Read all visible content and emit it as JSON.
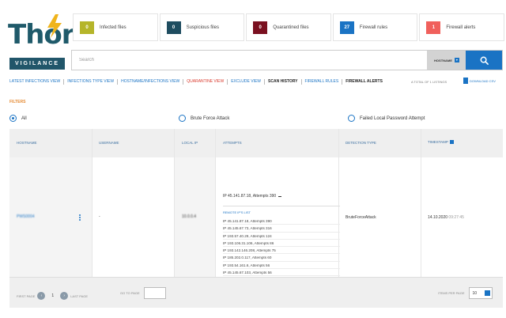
{
  "brand": {
    "logo": "Thor",
    "tagline": "VIGILANCE"
  },
  "stats": [
    {
      "count": "0",
      "label": "Infected files",
      "color": "#b5b52a"
    },
    {
      "count": "0",
      "label": "Suspicious files",
      "color": "#1f4d60"
    },
    {
      "count": "0",
      "label": "Quarantined files",
      "color": "#7a1020"
    },
    {
      "count": "27",
      "label": "Firewall rules",
      "color": "#1a73c4"
    },
    {
      "count": "1",
      "label": "Firewall alerts",
      "color": "#f0605c"
    }
  ],
  "search": {
    "placeholder": "Search",
    "filter_value": "HOSTNAME"
  },
  "nav": [
    "LATEST INFECTIONS VIEW",
    "INFECTIONS TYPE VIEW",
    "HOSTNAME/INFECTIONS VIEW",
    "QUARANTINE VIEW",
    "EXCLUDE VIEW",
    "SCAN HISTORY",
    "FIREWALL RULES",
    "FIREWALL ALERTS"
  ],
  "total_listings": "A TOTAL OF 1 LISTINGS",
  "download_csv": "DOWNLOAD CSV",
  "filters_label": "FILTERS",
  "filter_options": [
    "All",
    "Brute Force Attack",
    "Failed Local Password Attempt"
  ],
  "table": {
    "columns": [
      "HOSTNAME",
      "USERNAME",
      "LOCAL IP",
      "ATTEMPTS",
      "DETECTION TYPE",
      "TIMESTAMP"
    ],
    "row": {
      "hostname": "PWS0004",
      "username": "-",
      "local_ip": "10.0.0.4",
      "attempts_summary": "IP 45.141.87.18, Attempts 390",
      "remote_ips_label": "REMOTE IP'S LIST",
      "remote_ips": [
        "IP 45.141.87.18, Attempts 390",
        "IP 45.145.67.73, Attempts 316",
        "IP 193.57.40.29, Attempts 124",
        "IP 193.106.31.106, Attempts 86",
        "IP 193.142.146.208, Attempts 75",
        "IP 185.202.0.117, Attempts 60",
        "IP 193.54.161.6, Attempts 56",
        "IP 45.145.67.103, Attempts 56",
        "IP 45.145.66.175, Attempts 56",
        "IP 45.145.67.139, Attempts 56"
      ],
      "detection_type": "BruteForceAttack",
      "timestamp_date": "14.10.2020",
      "timestamp_time": "09:27:45"
    }
  },
  "pagination": {
    "first_page": "FIRST PAGE",
    "current_page": "1",
    "last_page": "LAST PAGE",
    "goto_label": "GO TO PAGE",
    "items_per_page_label": "ITEMS PER PAGE",
    "items_per_page_value": "10"
  }
}
